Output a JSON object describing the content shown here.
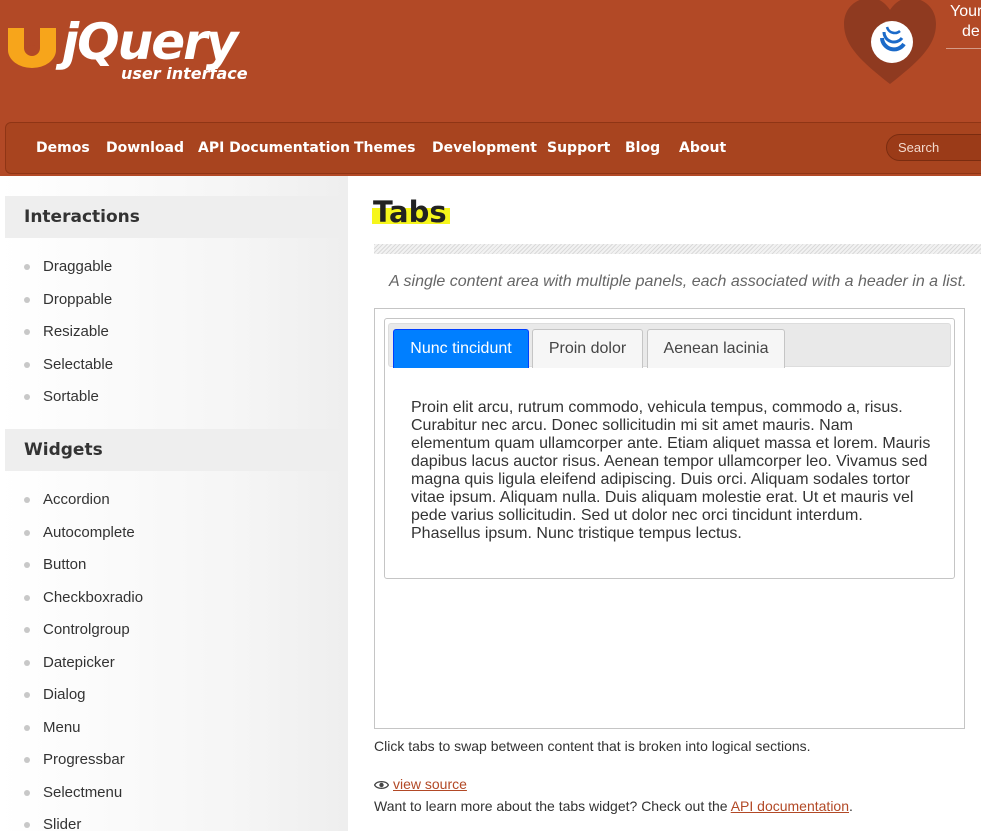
{
  "header": {
    "logo_word": "jQuery",
    "logo_sub": "user interface",
    "donate": {
      "line1": "Your",
      "line2": "de"
    },
    "search_placeholder": "Search",
    "nav": [
      "Demos",
      "Download",
      "API Documentation",
      "Themes",
      "Development",
      "Support",
      "Blog",
      "About"
    ]
  },
  "sidebar": {
    "sections": [
      {
        "title": "Interactions",
        "items": [
          "Draggable",
          "Droppable",
          "Resizable",
          "Selectable",
          "Sortable"
        ]
      },
      {
        "title": "Widgets",
        "items": [
          "Accordion",
          "Autocomplete",
          "Button",
          "Checkboxradio",
          "Controlgroup",
          "Datepicker",
          "Dialog",
          "Menu",
          "Progressbar",
          "Selectmenu",
          "Slider"
        ]
      }
    ]
  },
  "main": {
    "title": "Tabs",
    "subtitle": "A single content area with multiple panels, each associated with a header in a list.",
    "tabs": [
      {
        "label": "Nunc tincidunt",
        "active": true
      },
      {
        "label": "Proin dolor",
        "active": false
      },
      {
        "label": "Aenean lacinia",
        "active": false
      }
    ],
    "panel_text": "Proin elit arcu, rutrum commodo, vehicula tempus, commodo a, risus. Curabitur nec arcu. Donec sollicitudin mi sit amet mauris. Nam elementum quam ullamcorper ante. Etiam aliquet massa et lorem. Mauris dapibus lacus auctor risus. Aenean tempor ullamcorper leo. Vivamus sed magna quis ligula eleifend adipiscing. Duis orci. Aliquam sodales tortor vitae ipsum. Aliquam nulla. Duis aliquam molestie erat. Ut et mauris vel pede varius sollicitudin. Sed ut dolor nec orci tincidunt interdum. Phasellus ipsum. Nunc tristique tempus lectus.",
    "caption": "Click tabs to swap between content that is broken into logical sections.",
    "view_source": "view source",
    "learn_prefix": "Want to learn more about the tabs widget? Check out the ",
    "learn_link": "API documentation",
    "learn_suffix": "."
  },
  "colors": {
    "brand": "#b24926",
    "nav_bar": "#a8441f",
    "active_tab": "#007fff",
    "highlight": "#f6f61b",
    "link": "#b24926"
  },
  "icons": [
    "jquery-ui-logo-icon",
    "heart-icon",
    "eye-icon",
    "bullet-icon"
  ]
}
